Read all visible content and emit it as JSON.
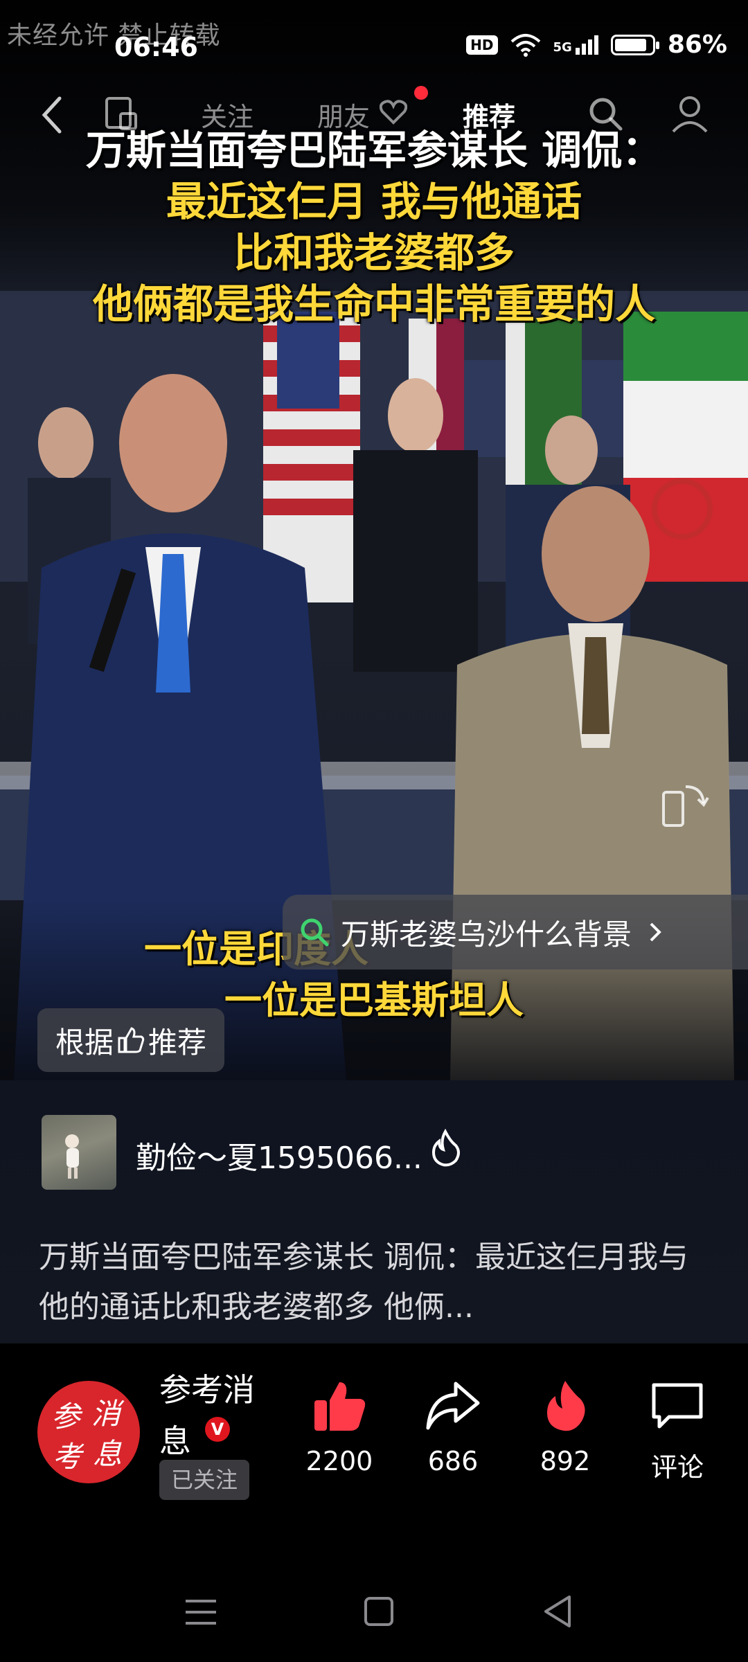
{
  "watermark": "未经允许 禁止转载",
  "status_bar": {
    "time": "06:46",
    "hd": "HD",
    "network": "5G",
    "battery": "86%",
    "battery_level": 0.86
  },
  "top_nav": {
    "tabs": [
      {
        "label": "关注",
        "active": false
      },
      {
        "label": "朋友",
        "active": false
      },
      {
        "label": "推荐",
        "active": true
      }
    ]
  },
  "video": {
    "caption_title": "万斯当面夸巴陆军参谋长 调侃：",
    "caption_lines": [
      "最近这仨月 我与他通话",
      "比和我老婆都多",
      "他俩都是我生命中非常重要的人"
    ],
    "subtitle_lines": [
      "一位是印度人",
      "一位是巴基斯坦人"
    ],
    "search_suggestion": "万斯老婆乌沙什么背景",
    "recommend_badge": [
      "根据",
      "推荐"
    ]
  },
  "author": {
    "name": "勤俭～夏1595066..."
  },
  "description": "万斯当面夸巴陆军参谋长 调侃：最近这仨月我与他的通话比和我老婆都多 他俩...",
  "publisher": {
    "name": "参考消息",
    "verified_mark": "V",
    "follow_state": "已关注",
    "logo_text": "参考消息"
  },
  "actions": {
    "likes": "2200",
    "shares": "686",
    "hot": "892",
    "comment_label": "评论"
  },
  "colors": {
    "caption_yellow": "#ffd83a",
    "accent_red": "#ff2b3b",
    "publisher_red": "#d8262c"
  }
}
